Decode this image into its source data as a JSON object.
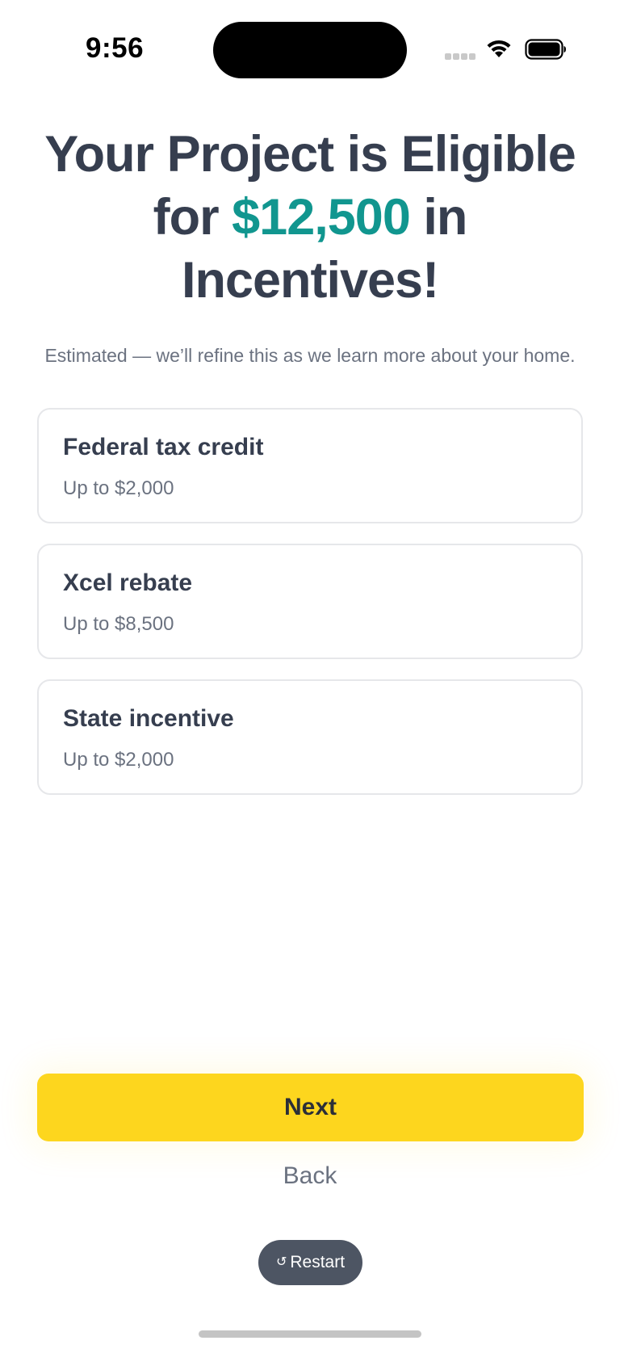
{
  "status_bar": {
    "time": "9:56",
    "icons": [
      "signal-dots-icon",
      "wifi-icon",
      "battery-icon"
    ]
  },
  "headline": {
    "prefix": "Your Project is Eligible for ",
    "amount": "$12,500",
    "suffix": " in Incentives!"
  },
  "subtitle": "Estimated — we’ll refine this as we learn more about your home.",
  "incentives": [
    {
      "title": "Federal tax credit",
      "amount": "Up to $2,000"
    },
    {
      "title": "Xcel rebate",
      "amount": "Up to $8,500"
    },
    {
      "title": "State incentive",
      "amount": "Up to $2,000"
    }
  ],
  "actions": {
    "next_label": "Next",
    "back_label": "Back",
    "restart_icon": "↺",
    "restart_label": "Restart"
  },
  "colors": {
    "accent_teal": "#11968f",
    "primary_yellow": "#fdd61e",
    "heading_text": "#363e4f",
    "muted_text": "#6b7280",
    "restart_bg": "#4d5563"
  }
}
